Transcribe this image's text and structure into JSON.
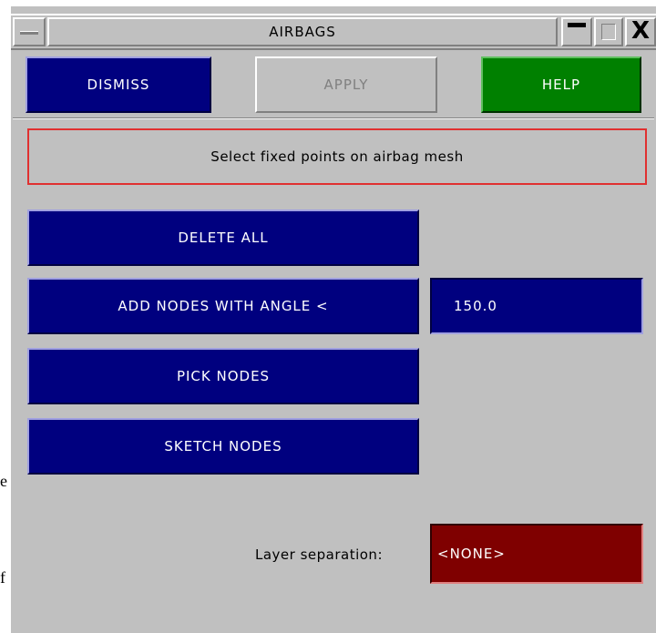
{
  "window": {
    "title": "AIRBAGS",
    "close_glyph": "X"
  },
  "toolbar": {
    "dismiss_label": "DISMISS",
    "apply_label": "APPLY",
    "help_label": "HELP"
  },
  "prompt": {
    "text": "Select fixed points on airbag mesh"
  },
  "actions": {
    "delete_all": "DELETE ALL",
    "add_nodes_angle": "ADD NODES WITH ANGLE <",
    "angle_value": "150.0",
    "pick_nodes": "PICK NODES",
    "sketch_nodes": "SKETCH NODES"
  },
  "layer": {
    "label": "Layer separation:",
    "value": "<NONE>"
  },
  "background": {
    "fragment_1": "e",
    "fragment_2": "f"
  },
  "colors": {
    "navy": "#00007f",
    "green": "#008000",
    "dark_red": "#7f0000",
    "panel": "#c0c0c0",
    "prompt_border": "#e03030"
  }
}
